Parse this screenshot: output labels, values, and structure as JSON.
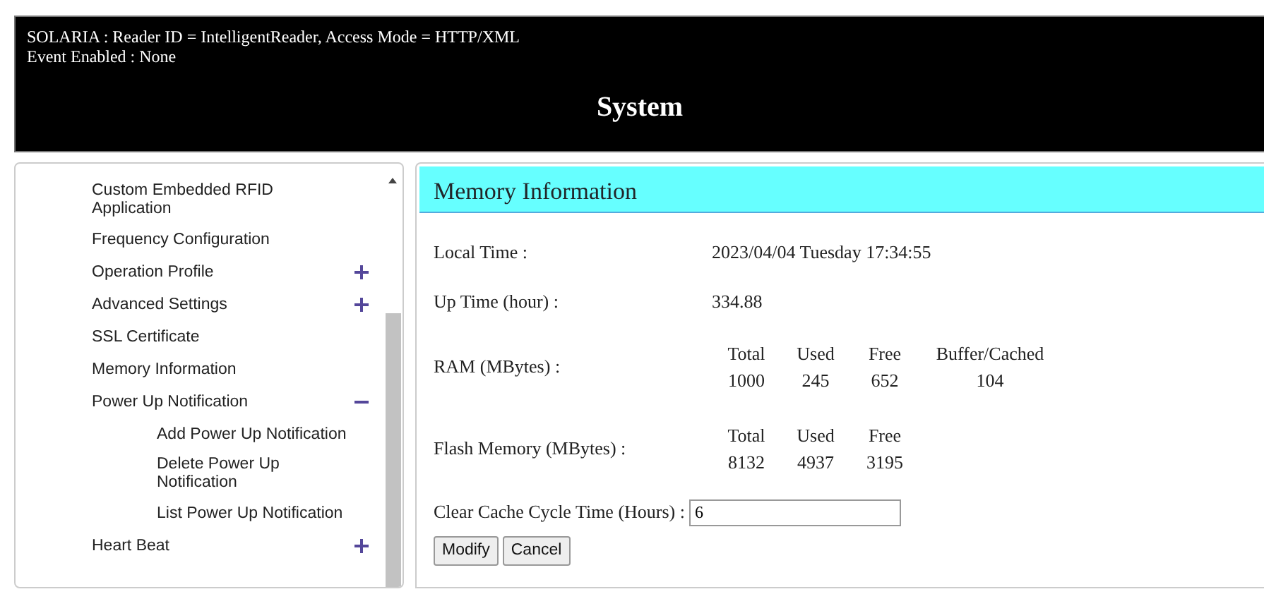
{
  "header": {
    "status_lines": [
      "SOLARIA : Reader ID = IntelligentReader, Access Mode = HTTP/XML",
      "Event Enabled : None"
    ],
    "title": "System"
  },
  "sidebar": {
    "items": [
      {
        "label": "Custom Embedded RFID Application"
      },
      {
        "label": "Frequency Configuration"
      },
      {
        "label": "Operation Profile",
        "expanded": false
      },
      {
        "label": "Advanced Settings",
        "expanded": false
      },
      {
        "label": "SSL Certificate"
      },
      {
        "label": "Memory Information"
      },
      {
        "label": "Power Up Notification",
        "expanded": true,
        "children": [
          {
            "label": "Add Power Up Notification"
          },
          {
            "label": "Delete Power Up Notification"
          },
          {
            "label": "List Power Up Notification"
          }
        ]
      },
      {
        "label": "Heart Beat",
        "expanded": false
      }
    ]
  },
  "panel": {
    "title": "Memory Information",
    "rows": [
      {
        "kind": "text",
        "label": "Local Time :",
        "value": "2023/04/04 Tuesday 17:34:55"
      },
      {
        "kind": "text",
        "label": "Up Time (hour) :",
        "value": "334.88"
      },
      {
        "kind": "table",
        "label": "RAM (MBytes) :",
        "columns": [
          {
            "heading": "Total",
            "value": "1000"
          },
          {
            "heading": "Used",
            "value": "245"
          },
          {
            "heading": "Free",
            "value": "652"
          },
          {
            "heading": "Buffer/Cached",
            "value": "104"
          }
        ]
      },
      {
        "kind": "table",
        "label": "Flash Memory (MBytes) :",
        "columns": [
          {
            "heading": "Total",
            "value": "8132"
          },
          {
            "heading": "Used",
            "value": "4937"
          },
          {
            "heading": "Free",
            "value": "3195"
          }
        ]
      },
      {
        "kind": "input",
        "label": "Clear Cache Cycle Time (Hours) :",
        "value": "6"
      }
    ],
    "buttons": [
      "Modify",
      "Cancel"
    ]
  }
}
